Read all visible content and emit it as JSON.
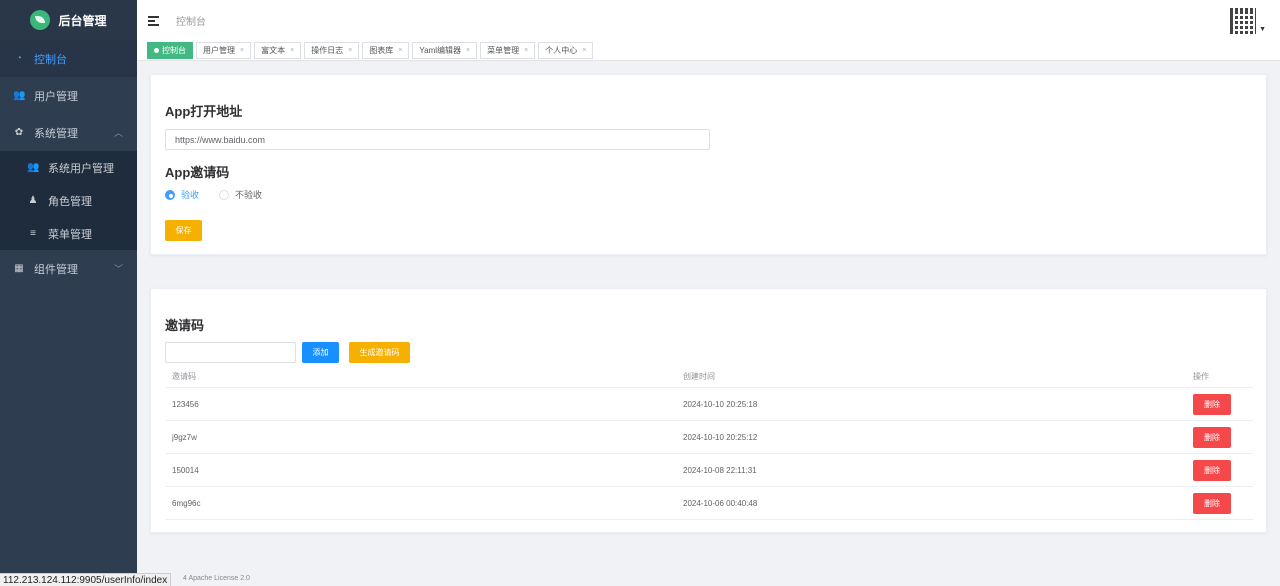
{
  "sidebar": {
    "logo_text": "后台管理",
    "items": [
      {
        "label": "控制台",
        "icon": "dashboard-icon"
      },
      {
        "label": "用户管理",
        "icon": "users-icon"
      },
      {
        "label": "系统管理",
        "icon": "gear-icon"
      },
      {
        "label": "组件管理",
        "icon": "grid-icon"
      }
    ],
    "system_sub": [
      {
        "label": "系统用户管理",
        "icon": "users-icon"
      },
      {
        "label": "角色管理",
        "icon": "person-icon"
      },
      {
        "label": "菜单管理",
        "icon": "list-icon"
      }
    ]
  },
  "header": {
    "breadcrumb": "控制台"
  },
  "tags": [
    {
      "label": "控制台"
    },
    {
      "label": "用户管理"
    },
    {
      "label": "富文本"
    },
    {
      "label": "操作日志"
    },
    {
      "label": "图表库"
    },
    {
      "label": "Yaml编辑器"
    },
    {
      "label": "菜单管理"
    },
    {
      "label": "个人中心"
    }
  ],
  "app_section": {
    "title": "App打开地址",
    "url_value": "https://www.baidu.com",
    "invite_title": "App邀请码",
    "radio_options": [
      "验收",
      "不验收"
    ],
    "selected": "验收",
    "save_label": "保存"
  },
  "invite_section": {
    "title": "邀请码",
    "input_value": "",
    "add_label": "添加",
    "generate_label": "生成邀请码",
    "columns": [
      "邀请码",
      "创建时间",
      "操作"
    ],
    "rows": [
      {
        "code": "123456",
        "created": "2024-10-10 20:25:18",
        "action": "删除"
      },
      {
        "code": "j9gz7w",
        "created": "2024-10-10 20:25:12",
        "action": "删除"
      },
      {
        "code": "150014",
        "created": "2024-10-08 22:11:31",
        "action": "删除"
      },
      {
        "code": "6mg96c",
        "created": "2024-10-06 00:40:48",
        "action": "删除"
      }
    ]
  },
  "footer": {
    "license": "4 Apache License 2.0"
  },
  "status_url": "112.213.124.112:9905/userInfo/index",
  "colors": {
    "sidebar_bg": "#2f3d51",
    "active_tag": "#42b983",
    "primary": "#1890ff",
    "warning": "#f5b000",
    "danger": "#f5484a"
  }
}
